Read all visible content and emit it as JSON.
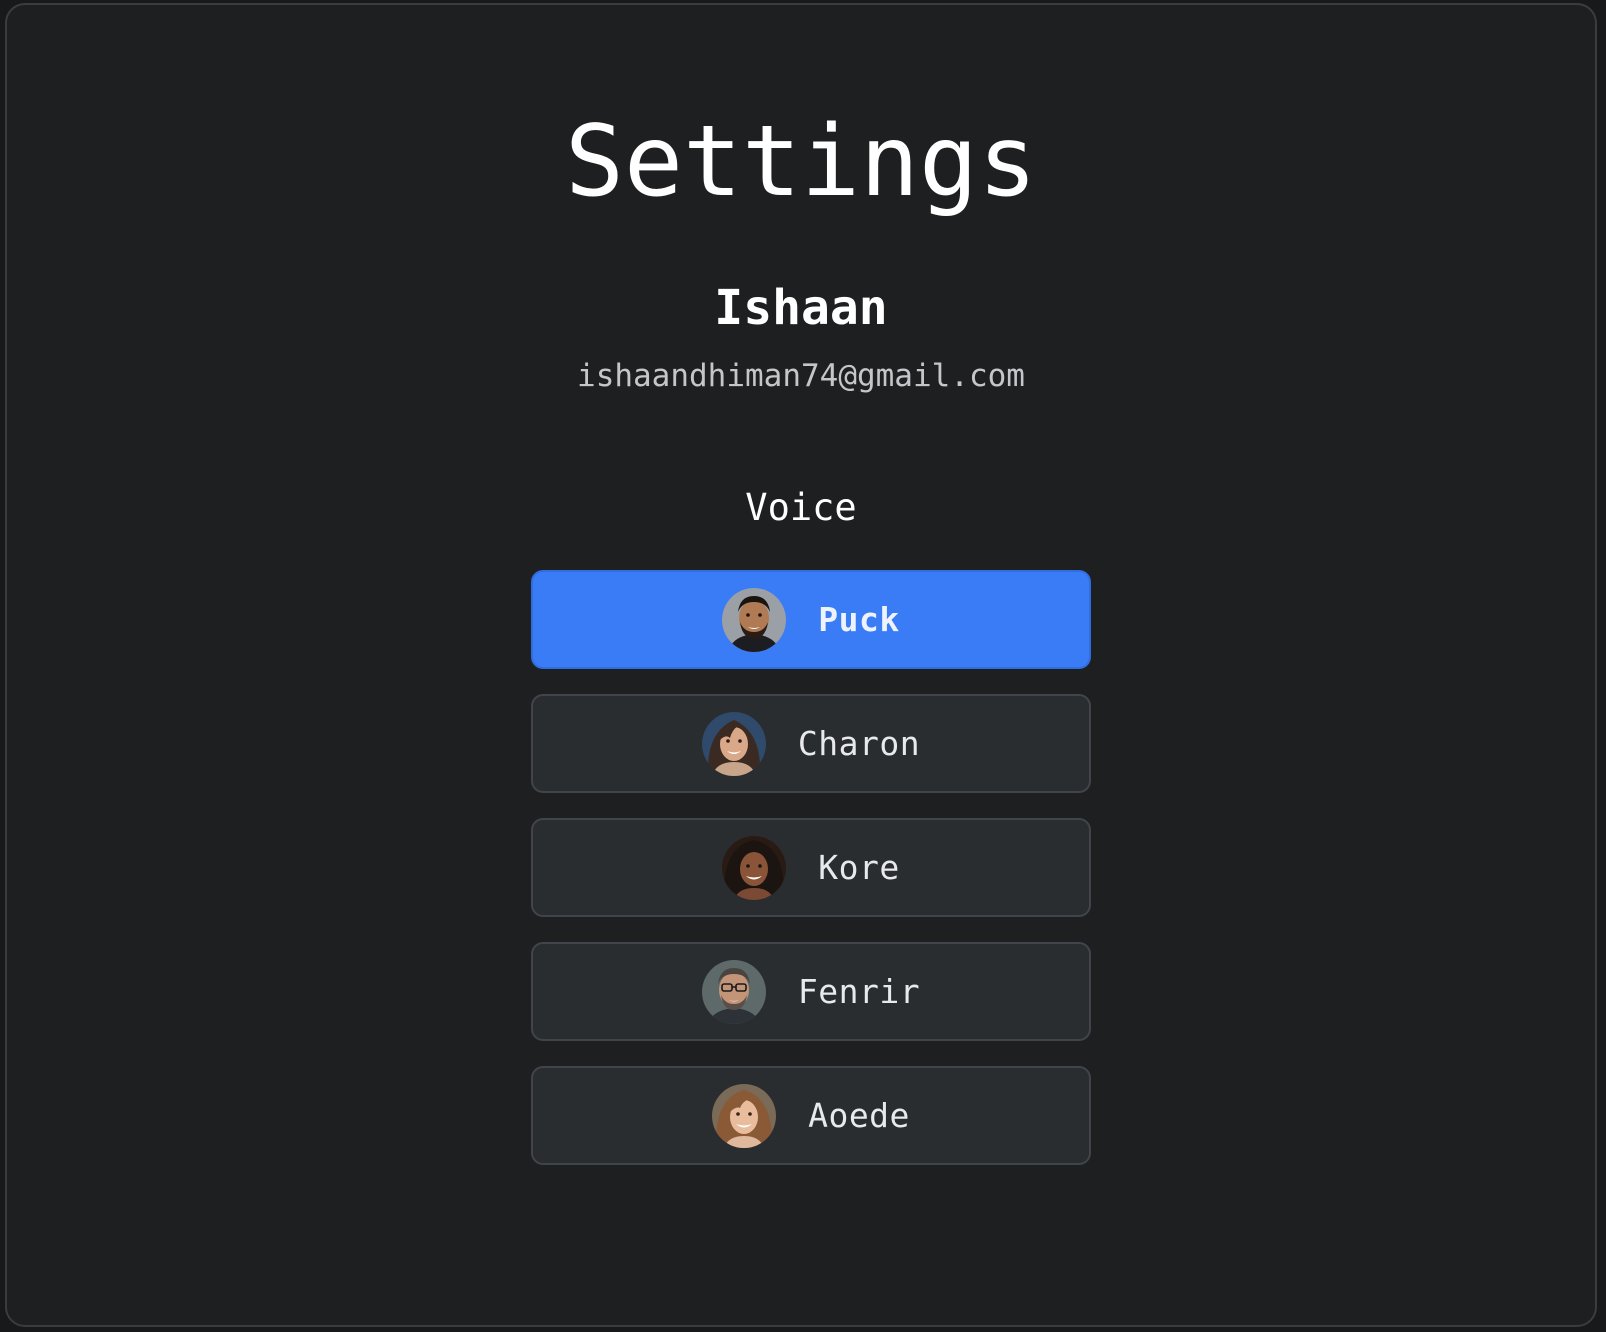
{
  "page": {
    "title": "Settings"
  },
  "user": {
    "name": "Ishaan",
    "email": "ishaandhiman74@gmail.com"
  },
  "voice_section": {
    "label": "Voice",
    "selected": "Puck",
    "options": [
      {
        "label": "Puck",
        "avatar": "man-beard-avatar",
        "selected": true
      },
      {
        "label": "Charon",
        "avatar": "woman-dark-hair-avatar",
        "selected": false
      },
      {
        "label": "Kore",
        "avatar": "woman-curly-hair-avatar",
        "selected": false
      },
      {
        "label": "Fenrir",
        "avatar": "man-glasses-avatar",
        "selected": false
      },
      {
        "label": "Aoede",
        "avatar": "woman-light-hair-avatar",
        "selected": false
      }
    ]
  },
  "colors": {
    "background": "#1e1f21",
    "accent": "#3a7bf6",
    "option_background": "#2a2d30",
    "option_border": "#41444a",
    "text_primary": "#ffffff",
    "text_secondary": "#c4c6ca"
  }
}
